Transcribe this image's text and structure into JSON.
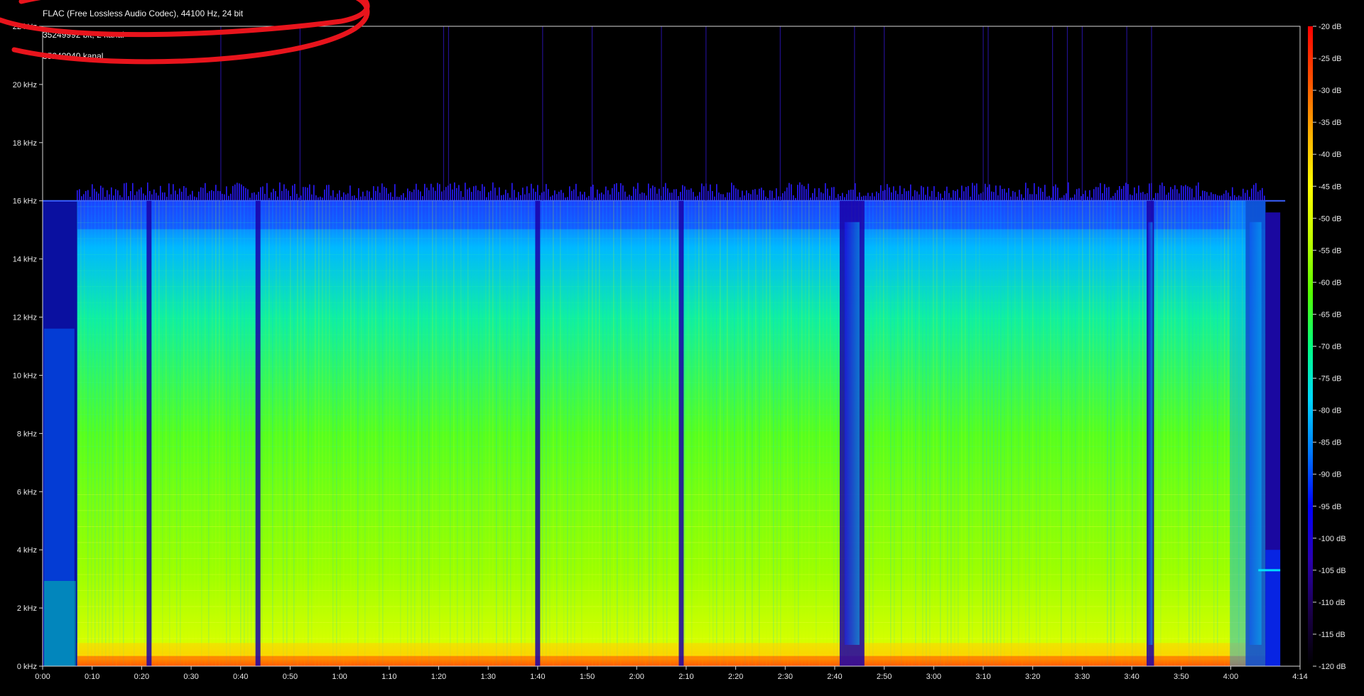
{
  "info": {
    "line1": "FLAC (Free Lossless Audio Codec), 44100 Hz, 24 bit",
    "line2": "35249992 bit, 2 kanal",
    "line3": "35249940 kanal"
  },
  "annotation_color": "#e8141c",
  "chart_data": {
    "type": "heatmap",
    "title": "",
    "xlabel": "",
    "ylabel": "",
    "x_ticks": [
      "0:00",
      "0:10",
      "0:20",
      "0:30",
      "0:40",
      "0:50",
      "1:00",
      "1:10",
      "1:20",
      "1:30",
      "1:40",
      "1:50",
      "2:00",
      "2:10",
      "2:20",
      "2:30",
      "2:40",
      "2:50",
      "3:00",
      "3:10",
      "3:20",
      "3:30",
      "3:40",
      "3:50",
      "4:00",
      "4:14"
    ],
    "y_ticks": [
      "0 kHz",
      "2 kHz",
      "4 kHz",
      "6 kHz",
      "8 kHz",
      "10 kHz",
      "12 kHz",
      "14 kHz",
      "16 kHz",
      "18 kHz",
      "20 kHz",
      "22 kHz"
    ],
    "xlim_seconds": [
      0,
      254
    ],
    "ylim_khz": [
      0,
      22
    ],
    "colorbar": {
      "ticks": [
        "-20 dB",
        "-25 dB",
        "-30 dB",
        "-35 dB",
        "-40 dB",
        "-45 dB",
        "-50 dB",
        "-55 dB",
        "-60 dB",
        "-65 dB",
        "-70 dB",
        "-75 dB",
        "-80 dB",
        "-85 dB",
        "-90 dB",
        "-95 dB",
        "-100 dB",
        "-105 dB",
        "-110 dB",
        "-115 dB",
        "-120 dB"
      ],
      "range_db": [
        -120,
        -20
      ],
      "colors": [
        "#000000",
        "#1a0047",
        "#2a00b0",
        "#0000ff",
        "#0078ff",
        "#00d8ff",
        "#00ff80",
        "#55ff00",
        "#c0ff00",
        "#ffff00",
        "#ffb000",
        "#ff5000",
        "#ff0000"
      ]
    },
    "cutoff_khz": 16,
    "audio_start_seconds": 7,
    "audio_end_seconds": 247,
    "quiet_segments_seconds": [
      [
        21,
        22
      ],
      [
        43,
        44
      ],
      [
        99.5,
        100.5
      ],
      [
        128.5,
        129.5
      ],
      [
        161,
        166
      ],
      [
        223,
        224.5
      ],
      [
        243,
        247
      ]
    ],
    "grid": false
  }
}
